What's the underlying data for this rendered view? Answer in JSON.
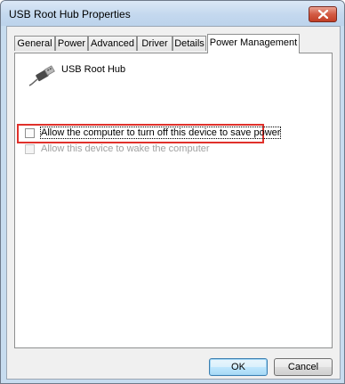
{
  "window": {
    "title": "USB Root Hub Properties"
  },
  "tabs": [
    {
      "label": "General"
    },
    {
      "label": "Power"
    },
    {
      "label": "Advanced"
    },
    {
      "label": "Driver"
    },
    {
      "label": "Details"
    },
    {
      "label": "Power Management",
      "active": true
    }
  ],
  "device": {
    "name": "USB Root Hub",
    "icon": "usb-plug-icon"
  },
  "options": [
    {
      "label": "Allow the computer to turn off this device to save power",
      "checked": false,
      "enabled": true
    },
    {
      "label": "Allow this device to wake the computer",
      "checked": false,
      "enabled": false
    }
  ],
  "buttons": {
    "ok_label": "OK",
    "cancel_label": "Cancel"
  },
  "colors": {
    "highlight": "#e0312b",
    "default_button": "#3c7fb1"
  }
}
